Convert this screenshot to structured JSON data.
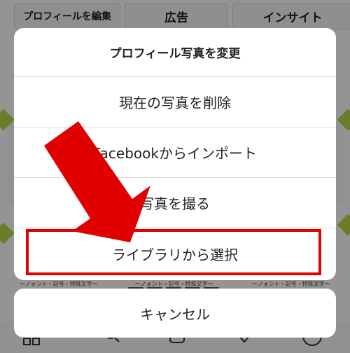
{
  "background": {
    "buttons": {
      "edit_profile": "プロフィールを編集",
      "ads": "広告",
      "insight": "インサイト"
    },
    "cell_caption": "〜ノォント・記号・特殊文字〜",
    "colors": {
      "ribbon": "#b9d84a"
    }
  },
  "sheet": {
    "title": "プロフィール写真を変更",
    "options": [
      "現在の写真を削除",
      "Facebookからインポート",
      "写真を撮る",
      "ライブラリから選択"
    ],
    "cancel": "キャンセル"
  },
  "annotation": {
    "color": "#e00000"
  }
}
